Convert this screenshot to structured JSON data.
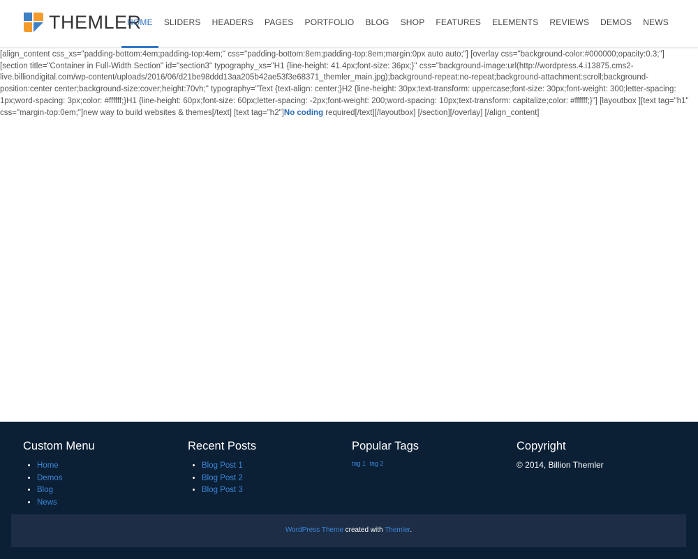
{
  "header": {
    "logo_text": "THEMLER",
    "nav": [
      {
        "label": "HOME",
        "active": true
      },
      {
        "label": "SLIDERS"
      },
      {
        "label": "HEADERS"
      },
      {
        "label": "PAGES"
      },
      {
        "label": "PORTFOLIO"
      },
      {
        "label": "BLOG"
      },
      {
        "label": "SHOP"
      },
      {
        "label": "FEATURES"
      },
      {
        "label": "ELEMENTS"
      },
      {
        "label": "REVIEWS"
      },
      {
        "label": "DEMOS"
      },
      {
        "label": "NEWS"
      }
    ]
  },
  "content": {
    "text_before": "[align_content css_xs=\"padding-bottom:4em;padding-top:4em;\" css=\"padding-bottom:8em;padding-top:8em;margin:0px auto auto;\"] [overlay css=\"background-color:#000000;opacity:0.3;\"] [section title=\"Container in Full-Width Section\" id=\"section3\" typography_xs=\"H1 {line-height: 41.4px;font-size: 36px;}\" css=\"background-image:url(http://wordpress.4.i13875.cms2-live.billiondigital.com/wp-content/uploads/2016/06/d21be98ddd13aa205b42ae53f3e68371_themler_main.jpg);background-repeat:no-repeat;background-attachment:scroll;background-position:center center;background-size:cover;height:70vh;\" typography=\"Text {text-align: center;}H2 {line-height: 30px;text-transform: uppercase;font-size: 30px;font-weight: 300;letter-spacing: 1px;word-spacing: 3px;color: #ffffff;}H1 {line-height: 60px;font-size: 60px;letter-spacing: -2px;font-weight: 200;word-spacing: 10px;text-transform: capitalize;color: #ffffff;}\"] [layoutbox ][text tag=\"h1\" css=\"margin-top:0em;\"]new way to build websites & themes[/text] [text tag=\"h2\"]",
    "link_text": "No coding",
    "text_after": " required[/text][/layoutbox] [/section][/overlay] [/align_content]"
  },
  "footer": {
    "custom_menu": {
      "title": "Custom Menu",
      "items": [
        "Home",
        "Demos",
        "Blog",
        "News"
      ]
    },
    "recent_posts": {
      "title": "Recent Posts",
      "items": [
        "Blog Post 1",
        "Blog Post 2",
        "Blog Post 3"
      ]
    },
    "popular_tags": {
      "title": "Popular Tags",
      "tags": [
        "tag 1",
        "tag 2"
      ]
    },
    "copyright": {
      "title": "Copyright",
      "text": "© 2014, Billion Themler"
    },
    "bottom": {
      "link1": "WordPress Theme",
      "middle": " created with ",
      "link2": "Themler",
      "end": "."
    }
  },
  "colors": {
    "accent": "#3178c6",
    "footer_bg": "#0b1f35",
    "footer_bar": "#1c2d45"
  }
}
